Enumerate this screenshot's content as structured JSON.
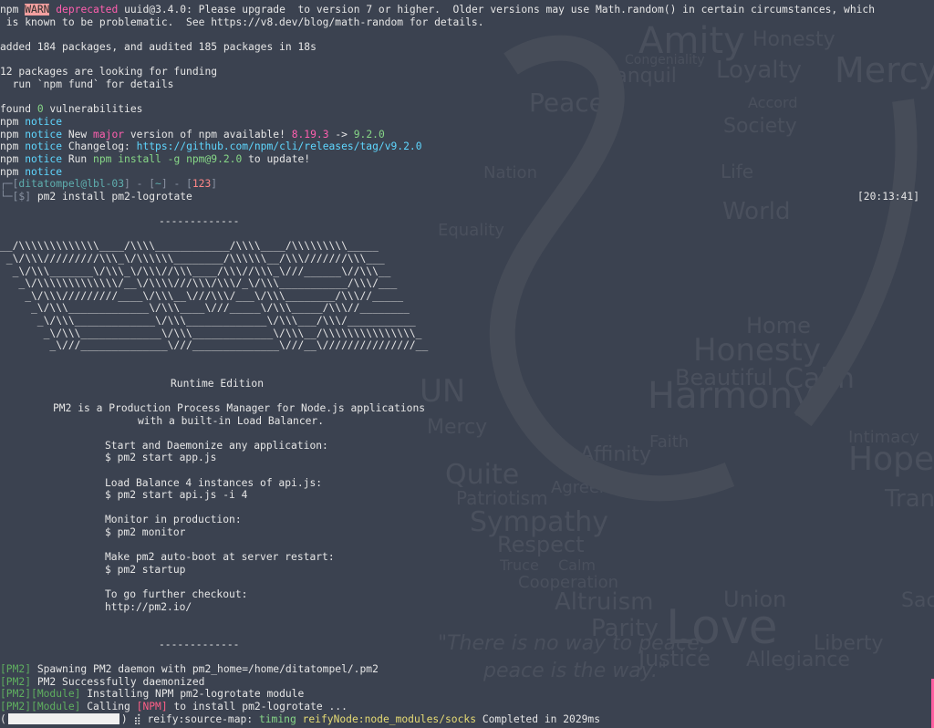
{
  "wallpaper": {
    "words": [
      "Amity",
      "Honesty",
      "Mercy",
      "Loyalty",
      "Tranquil",
      "Peace",
      "Society",
      "Life",
      "World",
      "Equality",
      "Harmony",
      "Honesty",
      "Beautiful",
      "Calm",
      "Hope",
      "Love",
      "Respect",
      "Sympathy",
      "Patriotism",
      "Quite",
      "Union",
      "Justice",
      "Allegiance",
      "Liberty",
      "Altruism",
      "Parity",
      "Affinity",
      "Agreement",
      "Cooperation",
      "Truce",
      "Calm",
      "Nation",
      "Mercy",
      "UN",
      "Faith",
      "Intimacy",
      "Tran",
      "Sacri",
      "Home",
      "Accord",
      "Congeniality"
    ],
    "quote": "\"There is no way to peace,",
    "quote2": "peace is the way.\""
  },
  "terminal": {
    "line_warn_1": {
      "npm": "npm ",
      "warn": "WARN",
      "dep": " deprecated",
      "rest": " uuid@3.4.0: Please upgrade  to version 7 or higher.  Older versions may use Math.random() in certain circumstances, which"
    },
    "line_warn_2": " is known to be problematic.  See https://v8.dev/blog/math-random for details.",
    "line_added": "added 184 packages, and audited 185 packages in 18s",
    "line_funding_1": "12 packages are looking for funding",
    "line_funding_2": "  run `npm fund` for details",
    "line_vuln": {
      "pre": "found ",
      "num": "0",
      "post": " vulnerabilities"
    },
    "notice_label": "notice",
    "npm_label": "npm ",
    "notice_1": "",
    "notice_2": {
      "a": " New ",
      "major": "major",
      "b": " version of npm available! ",
      "old": "8.19.3",
      "arrow": " -> ",
      "new": "9.2.0"
    },
    "notice_3": {
      "a": " Changelog: ",
      "url": "https://github.com/npm/cli/releases/tag/v9.2.0"
    },
    "notice_4": {
      "a": " Run ",
      "cmd": "npm install -g npm@9.2.0",
      "b": " to update!"
    },
    "prompt_1": {
      "pre": "┌─[",
      "user": "ditatompel@lbl-03",
      "mid": "] - [",
      "dir": "~",
      "mid2": "] - [",
      "num": "123",
      "post": "]"
    },
    "prompt_2": {
      "pre": "└─[$] ",
      "cmd": "pm2 install pm2-logrotate"
    },
    "clock": "[20:13:41]",
    "divider": "-------------",
    "ascii_art": [
      "__/\\\\\\\\\\\\\\\\\\\\\\\\\\____/\\\\\\\\____________/\\\\\\\\____/\\\\\\\\\\\\\\\\\\_____",
      " _\\/\\\\\\/////////\\\\\\_\\/\\\\\\\\\\\\________/\\\\\\\\\\\\__/\\\\\\///////\\\\\\___",
      "  _\\/\\\\\\_______\\/\\\\\\_\\/\\\\\\//\\\\\\____/\\\\\\//\\\\\\_\\///______\\//\\\\\\__",
      "   _\\/\\\\\\\\\\\\\\\\\\\\\\\\\\/__\\/\\\\\\\\///\\\\\\/\\\\\\/_\\/\\\\\\___________/\\\\\\/___",
      "    _\\/\\\\\\/////////____\\/\\\\\\__\\///\\\\\\/___\\/\\\\\\________/\\\\\\//_____",
      "     _\\/\\\\\\_____________\\/\\\\\\____\\///_____\\/\\\\\\_____/\\\\\\//________",
      "      _\\/\\\\\\_____________\\/\\\\\\_____________\\/\\\\\\___/\\\\\\/___________",
      "       _\\/\\\\\\_____________\\/\\\\\\_____________\\/\\\\\\__/\\\\\\\\\\\\\\\\\\\\\\\\\\\\\\_",
      "        _\\///______________\\///______________\\///__\\///////////////__"
    ],
    "runtime_edition": "Runtime Edition",
    "desc_1": "PM2 is a Production Process Manager for Node.js applications",
    "desc_2": "with a built-in Load Balancer.",
    "tips": [
      {
        "title": "Start and Daemonize any application:",
        "cmd": "$ pm2 start app.js"
      },
      {
        "title": "Load Balance 4 instances of api.js:",
        "cmd": "$ pm2 start api.js -i 4"
      },
      {
        "title": "Monitor in production:",
        "cmd": "$ pm2 monitor"
      },
      {
        "title": "Make pm2 auto-boot at server restart:",
        "cmd": "$ pm2 startup"
      },
      {
        "title": "To go further checkout:",
        "cmd": "http://pm2.io/"
      }
    ],
    "pm2_tag": "[PM2]",
    "module_tag": "[Module]",
    "npm_tag": "[NPM]",
    "log_1": " Spawning PM2 daemon with pm2_home=/home/ditatompel/.pm2",
    "log_2": " PM2 Successfully daemonized",
    "log_3": " Installing NPM pm2-logrotate module",
    "log_4a": " Calling ",
    "log_4b": " to install pm2-logrotate ...",
    "status": {
      "open": "(",
      "close": ") ⣾ ",
      "task": "reify:source-map:",
      "timing": "timing",
      "node": "reifyNode:node_modules/socks",
      "done": "Completed in 2029ms"
    }
  },
  "colors": {
    "background": "#3b4250",
    "npm_notice": "#5fd7ff",
    "pm2_tag": "#5faf5f",
    "warn_bg": "#f3a0a0",
    "accent_pink": "#ff5faf"
  }
}
